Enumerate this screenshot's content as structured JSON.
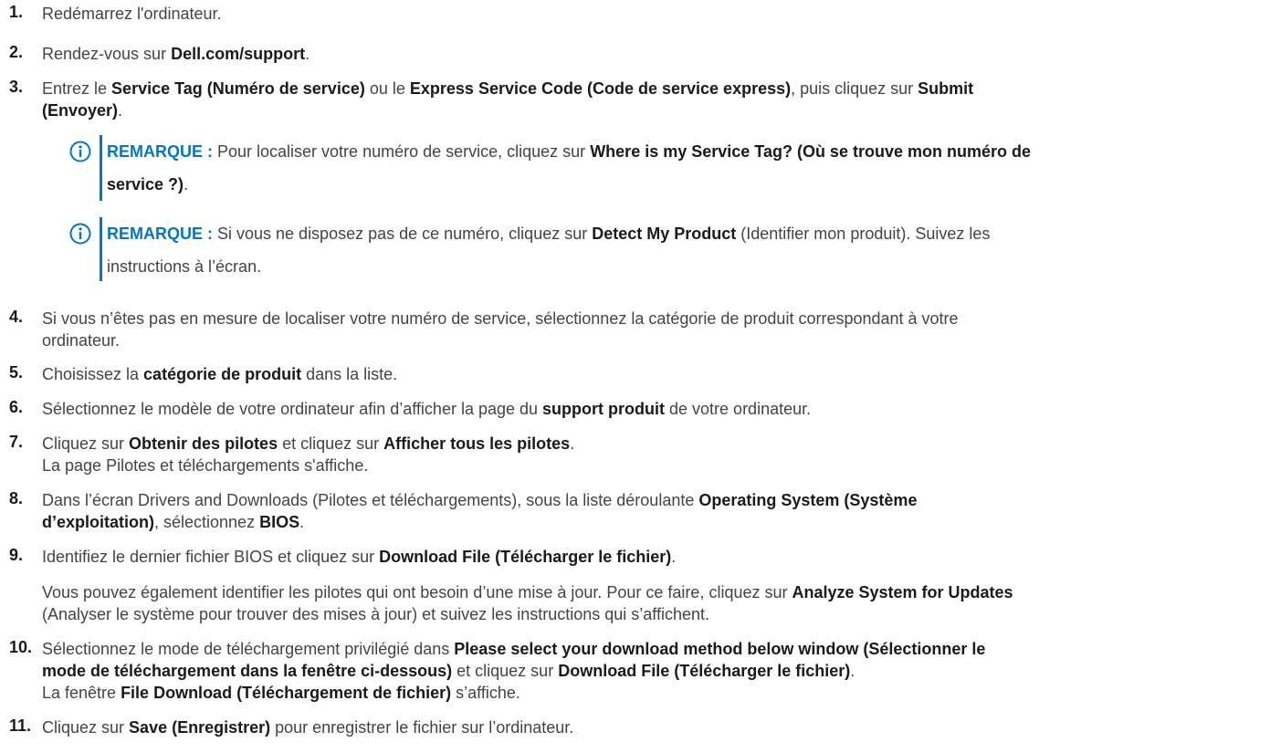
{
  "steps": [
    {
      "num": "1.",
      "parts": [
        {
          "t": "Redémarrez l'ordinateur."
        }
      ]
    },
    {
      "num": "2.",
      "parts": [
        {
          "t": "Rendez-vous sur "
        },
        {
          "t": "Dell.com/support",
          "b": true
        },
        {
          "t": "."
        }
      ]
    },
    {
      "num": "3.",
      "parts": [
        {
          "t": "Entrez le "
        },
        {
          "t": "Service Tag (Numéro de service)",
          "b": true
        },
        {
          "t": " ou le "
        },
        {
          "t": "Express Service Code (Code de service express)",
          "b": true
        },
        {
          "t": ", puis cliquez sur "
        },
        {
          "t": "Submit",
          "b": true
        },
        {
          "t": "\n"
        },
        {
          "t": "(Envoyer)",
          "b": true
        },
        {
          "t": "."
        }
      ]
    },
    {
      "num": "4.",
      "parts": [
        {
          "t": "Si vous n’êtes pas en mesure de localiser votre numéro de service, sélectionnez la catégorie de produit correspondant à votre\nordinateur."
        }
      ]
    },
    {
      "num": "5.",
      "parts": [
        {
          "t": "Choisissez la "
        },
        {
          "t": "catégorie de produit",
          "b": true
        },
        {
          "t": " dans la liste."
        }
      ]
    },
    {
      "num": "6.",
      "parts": [
        {
          "t": "Sélectionnez le modèle de votre ordinateur afin d’afficher la page du "
        },
        {
          "t": "support produit",
          "b": true
        },
        {
          "t": " de votre ordinateur."
        }
      ]
    },
    {
      "num": "7.",
      "parts": [
        {
          "t": "Cliquez sur "
        },
        {
          "t": "Obtenir des pilotes",
          "b": true
        },
        {
          "t": " et cliquez sur "
        },
        {
          "t": "Afficher tous les pilotes",
          "b": true
        },
        {
          "t": ".\nLa page Pilotes et téléchargements s'affiche."
        }
      ]
    },
    {
      "num": "8.",
      "parts": [
        {
          "t": "Dans l’écran Drivers and Downloads (Pilotes et téléchargements), sous la liste déroulante "
        },
        {
          "t": "Operating System (Système",
          "b": true
        },
        {
          "t": "\n"
        },
        {
          "t": "d’exploitation)",
          "b": true
        },
        {
          "t": ", sélectionnez "
        },
        {
          "t": "BIOS",
          "b": true
        },
        {
          "t": "."
        }
      ]
    },
    {
      "num": "9.",
      "parts": [
        {
          "t": "Identifiez le dernier fichier BIOS et cliquez sur "
        },
        {
          "t": "Download File (Télécharger le fichier)",
          "b": true
        },
        {
          "t": "."
        }
      ]
    },
    {
      "num": "",
      "parts": [
        {
          "t": "Vous pouvez également identifier les pilotes qui ont besoin d’une mise à jour. Pour ce faire, cliquez sur "
        },
        {
          "t": "Analyze System for Updates",
          "b": true
        },
        {
          "t": "\n(Analyser le système pour trouver des mises à jour) et suivez les instructions qui s’affichent."
        }
      ]
    },
    {
      "num": "10.",
      "parts": [
        {
          "t": "Sélectionnez le mode de téléchargement privilégié dans "
        },
        {
          "t": "Please select your download method below window (Sélectionner le\nmode de téléchargement dans la fenêtre ci-dessous)",
          "b": true
        },
        {
          "t": " et cliquez sur "
        },
        {
          "t": "Download File (Télécharger le fichier)",
          "b": true
        },
        {
          "t": ".\nLa fenêtre "
        },
        {
          "t": "File Download (Téléchargement de fichier)",
          "b": true
        },
        {
          "t": " s’affiche."
        }
      ]
    },
    {
      "num": "11.",
      "parts": [
        {
          "t": "Cliquez sur "
        },
        {
          "t": "Save (Enregistrer)",
          "b": true
        },
        {
          "t": " pour enregistrer le fichier sur l’ordinateur."
        }
      ]
    }
  ],
  "notes": [
    {
      "label": "REMARQUE :",
      "parts": [
        {
          "t": " Pour localiser votre numéro de service, cliquez sur "
        },
        {
          "t": "Where is my Service Tag? (Où se trouve mon numéro de\nservice ?)",
          "b": true
        },
        {
          "t": "."
        }
      ]
    },
    {
      "label": "REMARQUE :",
      "parts": [
        {
          "t": " Si vous ne disposez pas de ce numéro, cliquez sur "
        },
        {
          "t": "Detect My Product",
          "b": true
        },
        {
          "t": " (Identifier mon produit). Suivez les\ninstructions à l’écran."
        }
      ]
    }
  ],
  "colors": {
    "accent": "#0076ce",
    "text": "#444444",
    "bold": "#1a1a1a"
  },
  "icons": {
    "note": "info-circle-icon"
  }
}
